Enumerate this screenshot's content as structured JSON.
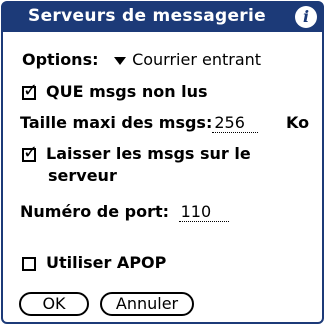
{
  "dialog": {
    "title": "Serveurs de messagerie",
    "info_icon": "i"
  },
  "options": {
    "label": "Options:",
    "selected": "Courrier entrant"
  },
  "que_non_lus": {
    "label": "QUE msgs non lus",
    "checked": true,
    "check_glyph": "✓"
  },
  "taille": {
    "label": "Taille maxi des msgs:",
    "value": "256",
    "unit": "Ko"
  },
  "laisser": {
    "line1": "Laisser les msgs sur le",
    "line2": "serveur",
    "checked": true,
    "check_glyph": "✓"
  },
  "port": {
    "label": "Numéro de port:",
    "value": "110"
  },
  "apop": {
    "label": "Utiliser APOP",
    "checked": false
  },
  "buttons": {
    "ok": "OK",
    "cancel": "Annuler"
  }
}
